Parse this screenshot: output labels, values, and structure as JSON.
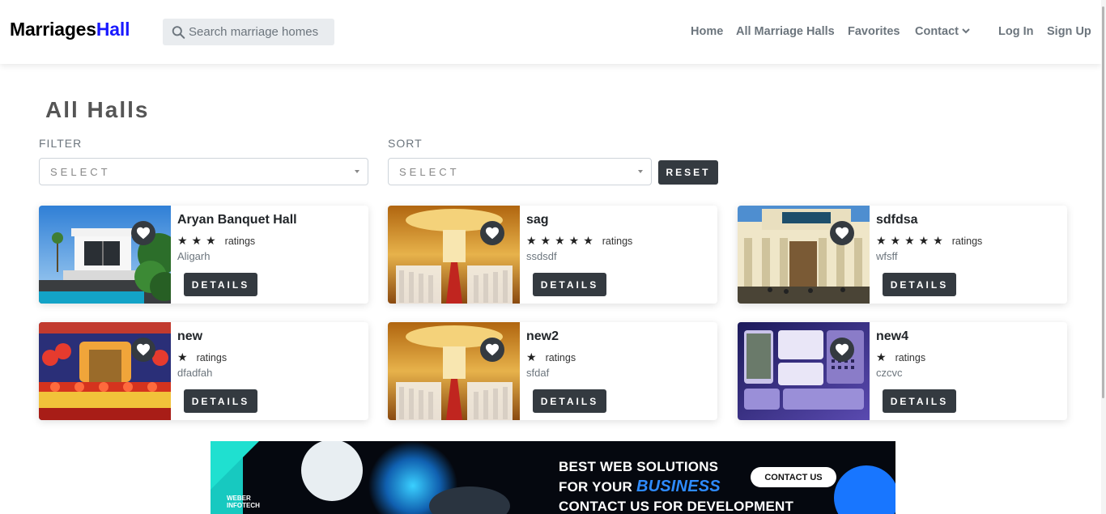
{
  "brand": {
    "part1": "Marriages",
    "part2": "Hall"
  },
  "search": {
    "placeholder": "Search marriage homes",
    "icon": "search-icon"
  },
  "nav": {
    "home": "Home",
    "all_halls": "All Marriage Halls",
    "favorites": "Favorites",
    "contact": "Contact",
    "login": "Log In",
    "signup": "Sign Up"
  },
  "page": {
    "title": "All Halls",
    "filter_label": "FILTER",
    "filter_value": "SELECT",
    "sort_label": "SORT",
    "sort_value": "SELECT",
    "reset_label": "RESET"
  },
  "halls": [
    {
      "name": "Aryan Banquet Hall",
      "stars": "★★★",
      "rating_label": "ratings",
      "location": "Aligarh",
      "details_label": "DETAILS"
    },
    {
      "name": "sag",
      "stars": "★★★★★",
      "rating_label": "ratings",
      "location": "ssdsdf",
      "details_label": "DETAILS"
    },
    {
      "name": "sdfdsa",
      "stars": "★★★★★",
      "rating_label": "ratings",
      "location": "wfsff",
      "details_label": "DETAILS"
    },
    {
      "name": "new",
      "stars": "★",
      "rating_label": "ratings",
      "location": "dfadfah",
      "details_label": "DETAILS"
    },
    {
      "name": "new2",
      "stars": "★",
      "rating_label": "ratings",
      "location": "sfdaf",
      "details_label": "DETAILS"
    },
    {
      "name": "new4",
      "stars": "★",
      "rating_label": "ratings",
      "location": "czcvc",
      "details_label": "DETAILS"
    }
  ],
  "banner": {
    "line1": "BEST WEB SOLUTIONS",
    "line2a": "FOR YOUR",
    "line2b": "BUSINESS",
    "line3": "CONTACT US FOR DEVELOPMENT",
    "cta": "CONTACT US",
    "logo1": "WEBER",
    "logo2": "INFOTECH"
  },
  "colors": {
    "brand_accent": "#1a1aff",
    "dark_button": "#343a40",
    "muted_text": "#6c757d"
  }
}
